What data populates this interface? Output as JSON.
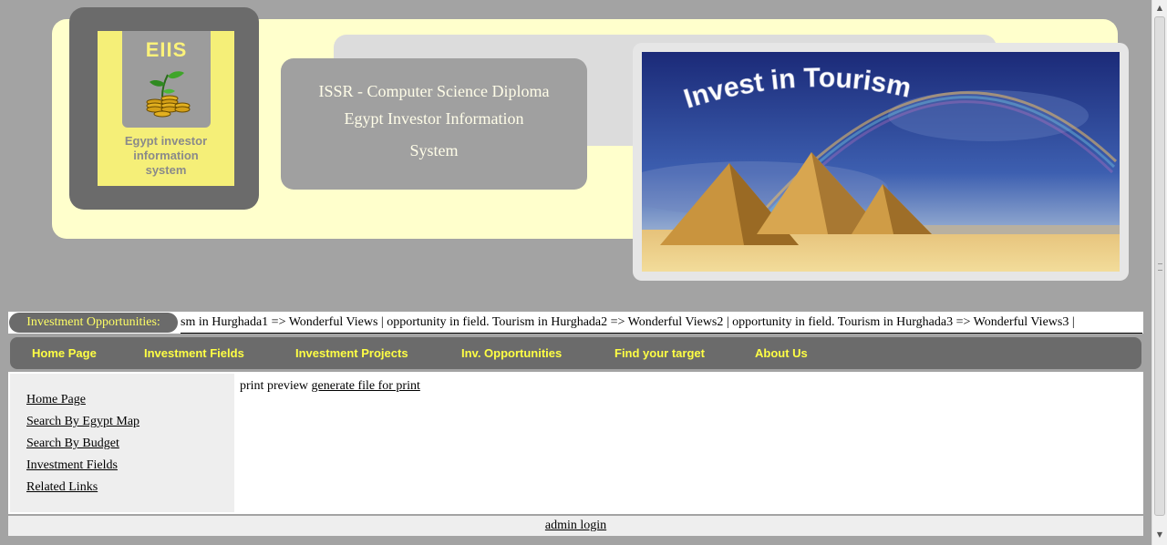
{
  "logo": {
    "abbr": "EIIS",
    "text_lines": [
      "Egypt investor",
      "information",
      "system"
    ]
  },
  "header": {
    "title_lines": [
      "ISSR - Computer Science Diploma",
      "Egypt Investor Information",
      "System"
    ]
  },
  "banner": {
    "text": "Invest in Tourism"
  },
  "ticker": {
    "label": "Investment Opportunities:",
    "text": "sm in Hurghada1 => Wonderful Views | opportunity in field. Tourism in Hurghada2 => Wonderful Views2 | opportunity in field. Tourism in Hurghada3 => Wonderful Views3 |"
  },
  "nav": {
    "items": [
      {
        "label": "Home Page"
      },
      {
        "label": "Investment Fields"
      },
      {
        "label": "Investment Projects"
      },
      {
        "label": "Inv. Opportunities"
      },
      {
        "label": "Find your target"
      },
      {
        "label": "About Us"
      }
    ]
  },
  "sidebar": {
    "links": [
      {
        "label": "Home Page"
      },
      {
        "label": "Search By Egypt Map"
      },
      {
        "label": "Search By Budget"
      },
      {
        "label": "Investment Fields"
      },
      {
        "label": "Related Links"
      }
    ]
  },
  "main": {
    "prefix": "print preview",
    "print_link": "generate file for print"
  },
  "footer": {
    "admin_link": "admin login"
  },
  "colors": {
    "page_bg": "#a3a3a3",
    "header_panel": "#ffffcc",
    "dark_grey": "#6b6b6b",
    "nav_text": "#ffff44",
    "logo_yellow": "#f5ef78"
  },
  "icons": {
    "logo_graphic": "plant-on-coins-icon",
    "scroll_up": "scroll-up-arrow-icon",
    "scroll_down": "scroll-down-arrow-icon"
  }
}
